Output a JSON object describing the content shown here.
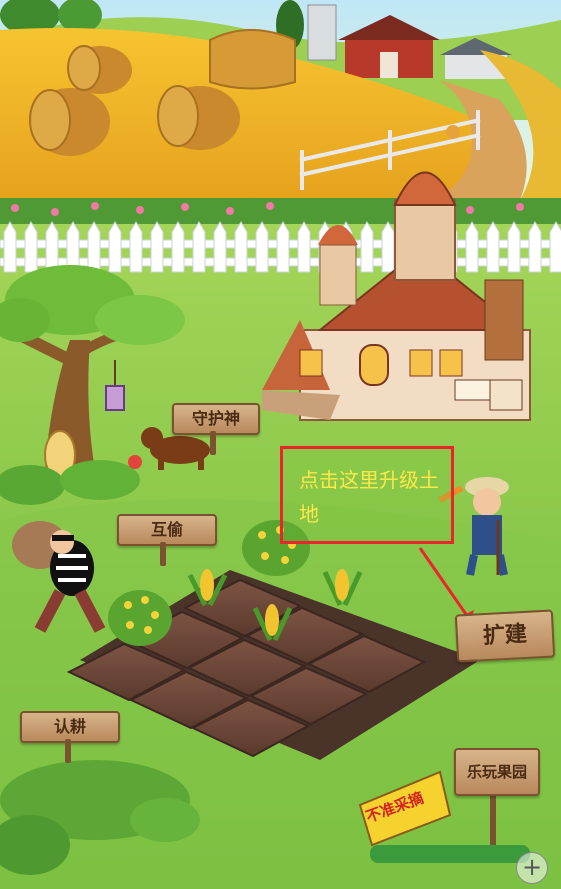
{
  "signs": {
    "guardian": "守护神",
    "mutual_steal": "互偷",
    "adopt": "认耕",
    "expand": "扩建",
    "fun_orchard": "乐玩果园",
    "no_picking": "不准采摘"
  },
  "tip": {
    "text": "点击这里升级土地",
    "border_color": "#e8262b",
    "text_color": "#ffe84a"
  },
  "zoom_icon": "+"
}
